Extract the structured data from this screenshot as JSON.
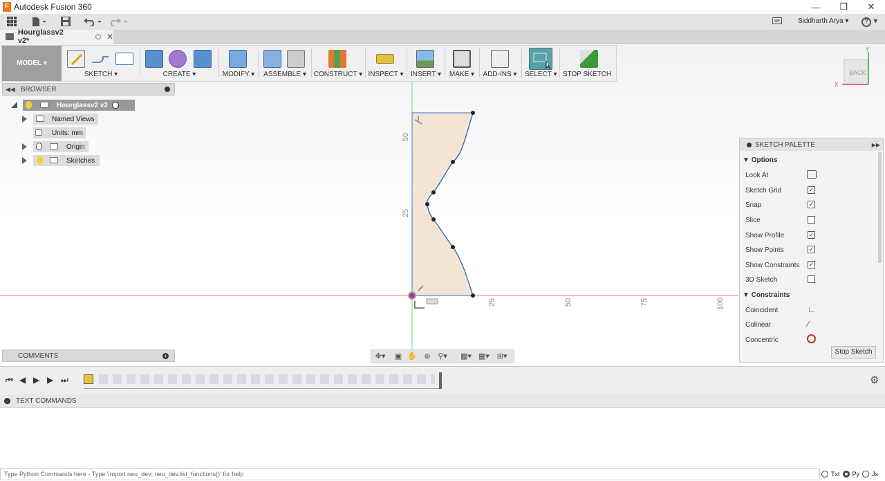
{
  "app": {
    "title": "Autodesk Fusion 360"
  },
  "user": {
    "name": "Siddharth Arya",
    "help": "?"
  },
  "document": {
    "tab_title": "Hourglassv2 v2*"
  },
  "toolbar": {
    "workspace": "MODEL",
    "groups": [
      "SKETCH",
      "CREATE",
      "MODIFY",
      "ASSEMBLE",
      "CONSTRUCT",
      "INSPECT",
      "INSERT",
      "MAKE",
      "ADD-INS",
      "SELECT",
      "STOP SKETCH"
    ]
  },
  "browser": {
    "title": "BROWSER",
    "root": "Hourglassv2 v2",
    "items": [
      "Named Views",
      "Units: mm",
      "Origin",
      "Sketches"
    ]
  },
  "comments": {
    "title": "COMMENTS"
  },
  "viewcube": {
    "face": "BACK",
    "axis_x": "X",
    "axis_y": "Y"
  },
  "sketch": {
    "vertical_ticks": [
      "50",
      "25"
    ],
    "horizontal_ticks": [
      "25",
      "50",
      "75",
      "100"
    ]
  },
  "palette": {
    "title": "SKETCH PALETTE",
    "options_header": "Options",
    "options": [
      {
        "label": "Look At",
        "control": "icon"
      },
      {
        "label": "Sketch Grid",
        "checked": true
      },
      {
        "label": "Snap",
        "checked": true
      },
      {
        "label": "Slice",
        "checked": false
      },
      {
        "label": "Show Profile",
        "checked": true
      },
      {
        "label": "Show Points",
        "checked": true
      },
      {
        "label": "Show Constraints",
        "checked": true
      },
      {
        "label": "3D Sketch",
        "checked": false
      }
    ],
    "constraints_header": "Constraints",
    "constraints": [
      "Coincident",
      "Colinear",
      "Concentric"
    ],
    "stop_button": "Stop Sketch"
  },
  "text_commands": {
    "title": "TEXT COMMANDS",
    "placeholder": "Type Python Commands here - Type 'import neu_dev; neu_dev.list_functions()' for help",
    "modes": [
      "Txt",
      "Py",
      "Js"
    ],
    "selected_mode": "Py"
  },
  "colors": {
    "accent": "#4c8fd6",
    "profile_fill": "#f5e4d4",
    "axis_red": "#e04040",
    "axis_green": "#3fb03f"
  }
}
